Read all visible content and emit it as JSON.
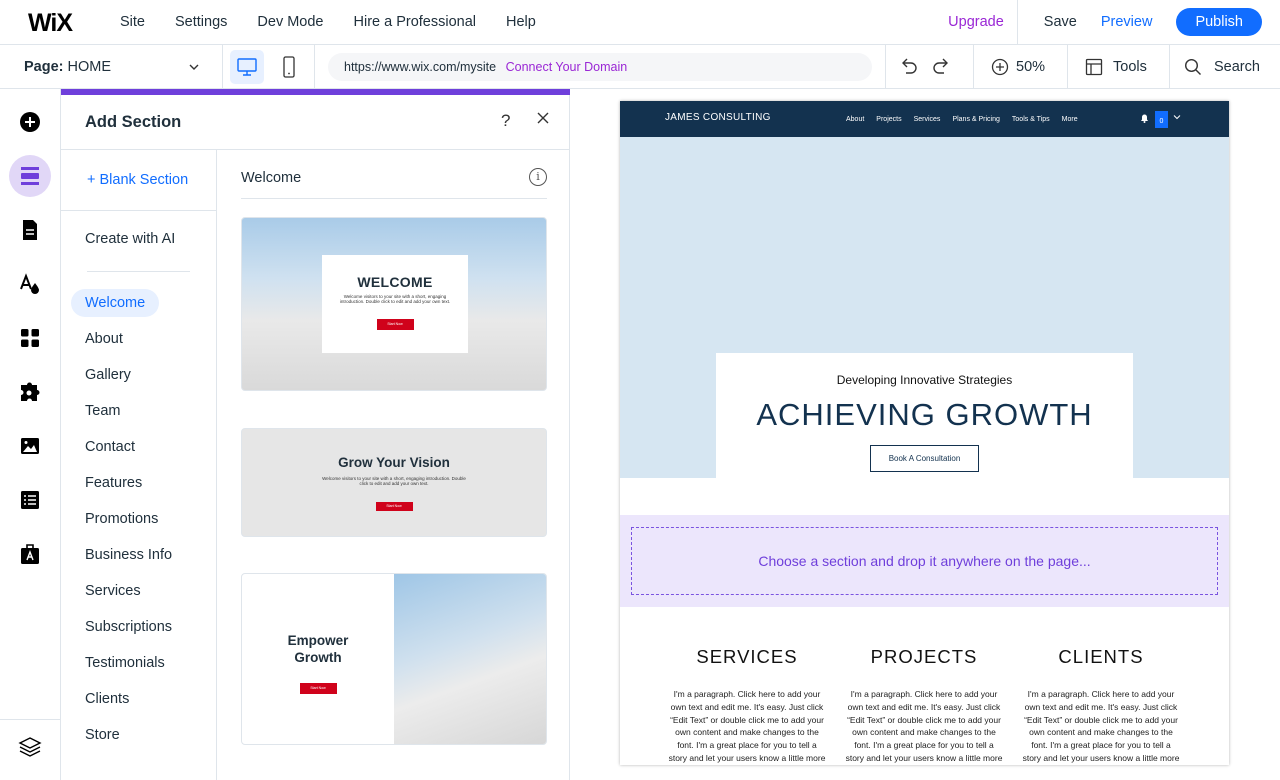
{
  "topbar": {
    "logo": "WiX",
    "menu": [
      "Site",
      "Settings",
      "Dev Mode",
      "Hire a Professional",
      "Help"
    ],
    "upgrade": "Upgrade",
    "save": "Save",
    "preview": "Preview",
    "publish": "Publish"
  },
  "secondbar": {
    "page_label": "Page:",
    "page_name": "HOME",
    "url": "https://www.wix.com/mysite",
    "connect_domain": "Connect Your Domain",
    "zoom": "50%",
    "tools": "Tools",
    "search": "Search"
  },
  "panel": {
    "title": "Add Section",
    "blank_section": "+ Blank Section",
    "create_ai": "Create with AI",
    "categories": [
      "Welcome",
      "About",
      "Gallery",
      "Team",
      "Contact",
      "Features",
      "Promotions",
      "Business Info",
      "Services",
      "Subscriptions",
      "Testimonials",
      "Clients",
      "Store"
    ],
    "active_category": "Welcome",
    "preview_heading": "Welcome",
    "thumb1_title": "WELCOME",
    "thumb1_text": "Welcome visitors to your site with a short, engaging introduction. Double click to edit and add your own text.",
    "thumb1_btn": "Start Now",
    "thumb2_title": "Grow Your Vision",
    "thumb2_text": "Welcome visitors to your site with a short, engaging introduction. Double click to edit and add your own text.",
    "thumb2_btn": "Start Now",
    "thumb3_title": "Empower Growth",
    "thumb3_btn": "Start Now"
  },
  "site": {
    "brand": "JAMES CONSULTING",
    "nav": [
      "About",
      "Projects",
      "Services",
      "Plans & Pricing",
      "Tools & Tips",
      "More"
    ],
    "cart_count": "0",
    "hero_subtitle": "Developing Innovative Strategies",
    "hero_title": "ACHIEVING GROWTH",
    "hero_button": "Book A Consultation",
    "dropzone": "Choose a section and drop it anywhere on the page...",
    "columns": [
      {
        "title": "SERVICES",
        "text": "I'm a paragraph. Click here to add your own text and edit me. It's easy. Just click “Edit Text” or double click me to add your own content and make changes to the font. I'm a great place for you to tell a story and let your users know a little more about you."
      },
      {
        "title": "PROJECTS",
        "text": "I'm a paragraph. Click here to add your own text and edit me. It's easy. Just click “Edit Text” or double click me to add your own content and make changes to the font. I'm a great place for you to tell a story and let your users know a little more about you."
      },
      {
        "title": "CLIENTS",
        "text": "I'm a paragraph. Click here to add your own text and edit me. It's easy. Just click “Edit Text” or double click me to add your own content and make changes to the font. I'm a great place for you to tell a story and let your users know a little more about you."
      }
    ]
  },
  "colors": {
    "accent": "#116dff",
    "upgrade": "#9a27d5",
    "panel_accent": "#6f3fdb",
    "site_nav": "#13324f",
    "hero_bg": "#d6e6f2"
  }
}
